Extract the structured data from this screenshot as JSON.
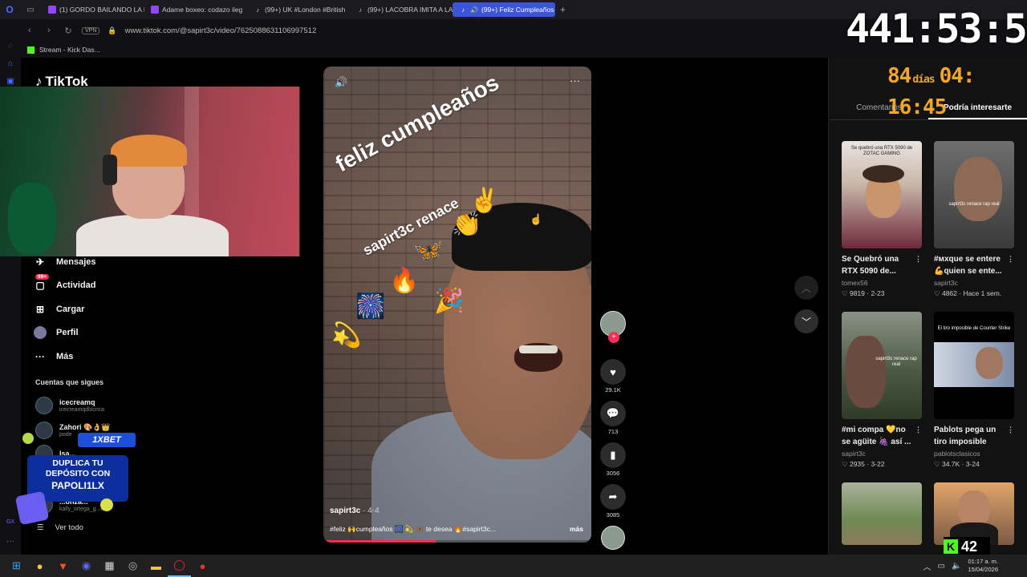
{
  "browser": {
    "tabs": [
      {
        "label": "(1) GORDO BAILANDO LA L",
        "icon": "twitch-icon",
        "color": "#9146ff"
      },
      {
        "label": "Adame boxeo: codazo ileg",
        "icon": "twitch-icon",
        "color": "#9146ff"
      },
      {
        "label": "(99+) UK #London #British",
        "icon": "tiktok-icon",
        "color": "#ffffff"
      },
      {
        "label": "(99+) LACOBRA IMITA A LA",
        "icon": "tiktok-icon",
        "color": "#ffffff"
      },
      {
        "label": "(99+) Feliz Cumpleaños",
        "icon": "tiktok-icon",
        "color": "#ffffff",
        "active": true
      }
    ],
    "address": "www.tiktok.com/@sapirt3c/video/7625088631106997512",
    "vpn_label": "VPN",
    "bookmark": "Stream - Kick Das..."
  },
  "stream_overlay": {
    "timer_big": "441:53:53",
    "timer_days": "84",
    "timer_days_label": "días",
    "timer_small": "04: 16:45",
    "kick_viewers": "42"
  },
  "tiktok": {
    "logo": "TikTok",
    "nav": [
      {
        "label": "Mensajes",
        "icon": "message-icon"
      },
      {
        "label": "Actividad",
        "icon": "activity-icon",
        "badge": "99+"
      },
      {
        "label": "Cargar",
        "icon": "upload-icon"
      },
      {
        "label": "Perfil",
        "icon": "profile-icon"
      },
      {
        "label": "Más",
        "icon": "more-icon"
      }
    ],
    "following_title": "Cuentas que sigues",
    "following": [
      {
        "name": "icecreamq",
        "handle": "icecreamqdlxcnca"
      },
      {
        "name": "Zahori 🎨👌👑",
        "handle": "pode"
      },
      {
        "name": "Isa...",
        "handle": ""
      },
      {
        "name": "...onzá...",
        "handle": "kally_ortega_g...lez"
      }
    ],
    "see_all": "Ver todo",
    "promo": {
      "brand": "1XBET",
      "line1": "DUPLICA TU",
      "line2": "DEPÓSITO CON",
      "code": "PAPOLI1LX"
    }
  },
  "video": {
    "overlay_line1": "feliz cumpleaños",
    "overlay_line2": "sapirt3c renace",
    "author": "sapirt3c",
    "date": " · 4-4",
    "caption": "#feliz 🙌cumpleaños 🎆 💫 🦋 te desea 🔥#sapirt3c...",
    "more": "más",
    "progress": 0.42
  },
  "actions": {
    "likes": "29.1K",
    "comments": "713",
    "saves": "3056",
    "shares": "3085"
  },
  "right_panel": {
    "tabs": [
      "Comentarios",
      "Podría interesarte"
    ],
    "active_tab": 1,
    "cards": [
      {
        "title": "Se Quebró una RTX 5090 de...",
        "author": "tomex56",
        "stats": "♡ 9819 · 2-23",
        "thumb_caption": "Se quebró una RTX 5090 de ZOTAC GAMING"
      },
      {
        "title": "#мxque se entere 💪quien se ente...",
        "author": "sapirt3c",
        "stats": "♡ 4862 · Hace 1 sem.",
        "thumb_caption": "sapirt3c renace rap real"
      },
      {
        "title": "#mi compa 💛no se agüite 🍇 así ...",
        "author": "sapirt3c",
        "stats": "♡ 2935 · 3-22",
        "thumb_caption": "sapirt3c renace rap real"
      },
      {
        "title": "Pablots pega un tiro imposible en...",
        "author": "pablotsclasicos",
        "stats": "♡ 34.7K · 3-24",
        "thumb_caption": "El tiro imposible de Counter Strike"
      }
    ]
  },
  "taskbar": {
    "time": "01:17 a. m.",
    "date": "15/04/2026"
  }
}
